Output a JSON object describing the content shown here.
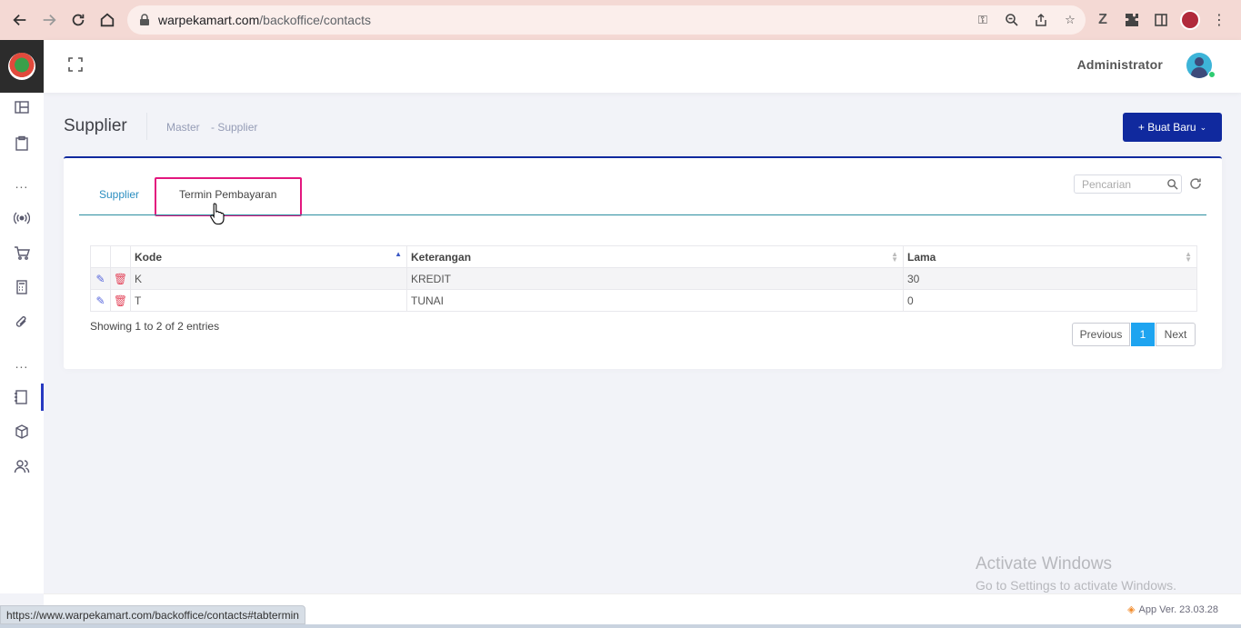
{
  "browser": {
    "url_host": "warpekamart.com",
    "url_path": "/backoffice/contacts",
    "status_url": "https://www.warpekamart.com/backoffice/contacts#tabtermin"
  },
  "header": {
    "user_name": "Administrator"
  },
  "page": {
    "title": "Supplier",
    "breadcrumb": [
      "Master",
      "- Supplier"
    ],
    "new_button": "+ Buat Baru"
  },
  "tabs": [
    {
      "label": "Supplier"
    },
    {
      "label": "Termin Pembayaran"
    }
  ],
  "search": {
    "placeholder": "Pencarian"
  },
  "table": {
    "columns": [
      "Kode",
      "Keterangan",
      "Lama"
    ],
    "rows": [
      {
        "kode": "K",
        "keterangan": "KREDIT",
        "lama": "30"
      },
      {
        "kode": "T",
        "keterangan": "TUNAI",
        "lama": "0"
      }
    ]
  },
  "table_info": "Showing 1 to 2 of 2 entries",
  "pagination": {
    "previous": "Previous",
    "current": "1",
    "next": "Next"
  },
  "footer": {
    "app_version": "App Ver. 23.03.28"
  },
  "watermark": {
    "title": "Activate Windows",
    "subtitle": "Go to Settings to activate Windows."
  },
  "colors": {
    "primary": "#10299e",
    "tab_active": "#2b8ec0",
    "highlight": "#e3177e",
    "page_active": "#1ea4f0"
  }
}
